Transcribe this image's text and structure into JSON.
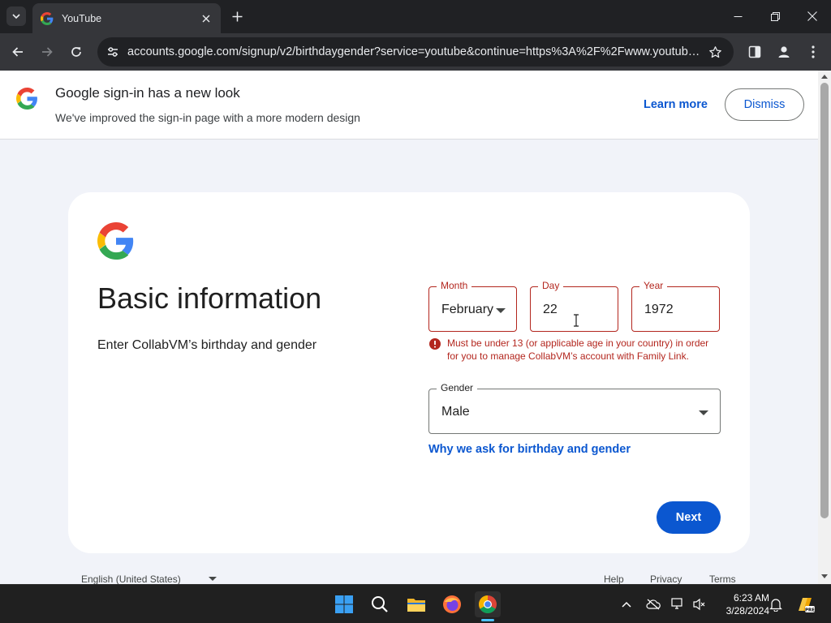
{
  "browser": {
    "tab_title": "YouTube",
    "url": "accounts.google.com/signup/v2/birthdaygender?service=youtube&continue=https%3A%2F%2Fwww.youtube.co..."
  },
  "banner": {
    "title": "Google sign-in has a new look",
    "subtitle": "We've improved the sign-in page with a more modern design",
    "learn_more": "Learn more",
    "dismiss": "Dismiss"
  },
  "form": {
    "heading": "Basic information",
    "subheading": "Enter CollabVM’s birthday and gender",
    "month": {
      "label": "Month",
      "value": "February"
    },
    "day": {
      "label": "Day",
      "value": "22"
    },
    "year": {
      "label": "Year",
      "value": "1972"
    },
    "error": "Must be under 13 (or applicable age in your country) in order for you to manage CollabVM’s account with Family Link.",
    "gender": {
      "label": "Gender",
      "value": "Male"
    },
    "why_link": "Why we ask for birthday and gender",
    "next": "Next"
  },
  "footer": {
    "language": "English (United States)",
    "help": "Help",
    "privacy": "Privacy",
    "terms": "Terms"
  },
  "taskbar": {
    "time": "6:23 AM",
    "date": "3/28/2024"
  },
  "colors": {
    "accent": "#0b57d0",
    "error": "#b3261e",
    "chrome_dark": "#202124",
    "page_bg": "#f1f3f9"
  }
}
